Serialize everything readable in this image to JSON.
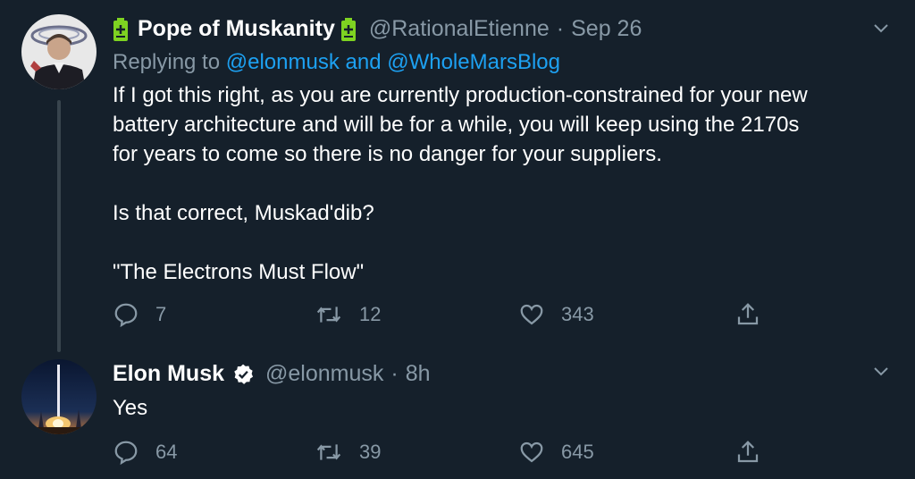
{
  "tweets": [
    {
      "display_name": "Pope of Muskanity",
      "handle": "@RationalEtienne",
      "separator": "·",
      "time": "Sep 26",
      "replying_prefix": "Replying to",
      "replying_user1": "@elonmusk",
      "replying_and": "and",
      "replying_user2": "@WholeMarsBlog",
      "body": "If I got this right, as you are currently production-constrained for your new\nbattery architecture and will be for a while, you will keep using the 2170s\nfor years to come so there is no danger for your suppliers.\n\nIs that correct, Muskad'dib?\n\n\"The Electrons Must Flow\"",
      "reply_count": "7",
      "retweet_count": "12",
      "like_count": "343",
      "icons": [
        "battery-icon",
        "reply-icon",
        "retweet-icon",
        "like-icon",
        "share-icon",
        "chevron-down-icon"
      ]
    },
    {
      "display_name": "Elon Musk",
      "handle": "@elonmusk",
      "separator": "·",
      "time": "8h",
      "body": "Yes",
      "reply_count": "64",
      "retweet_count": "39",
      "like_count": "645",
      "icons": [
        "verified-badge-icon",
        "reply-icon",
        "retweet-icon",
        "like-icon",
        "share-icon",
        "chevron-down-icon"
      ]
    }
  ],
  "colors": {
    "background": "#15202b",
    "text": "#ffffff",
    "secondary": "#8899a6",
    "link": "#1da1f2",
    "battery": "#7ed321",
    "thread_line": "#38444d"
  }
}
